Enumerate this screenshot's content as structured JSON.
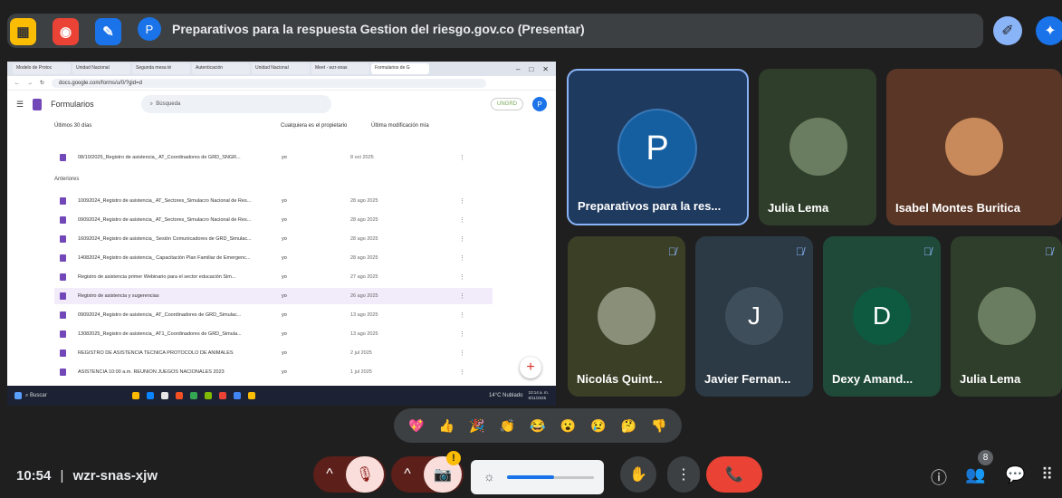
{
  "top_bar": {
    "title": "Preparativos para la respuesta Gestion del riesgo.gov.co (Presentar)",
    "avatar_letter": "P"
  },
  "shared_screen": {
    "tabs": [
      "Modelo de Protoc",
      "Unidad Nacional",
      "Segunda mesa té",
      "Autenticación",
      "Unidad Nacional",
      "Meet - wzr-snas",
      "Formularios de G"
    ],
    "url": "docs.google.com/forms/u/0/?gid=d",
    "forms_label": "Formularios",
    "search_placeholder": "Búsqueda",
    "badge": "UNGRD",
    "filter_range": "Últimos 30 días",
    "filter_owner": "Cualquiera es el propietario",
    "filter_modified": "Última modificación mía",
    "section_older": "Anteriores",
    "rows": [
      {
        "name": "08/10/2025_Registro de asistencia_ AT_Coordinadores de GRD_SNGR...",
        "owner": "yo",
        "date": "8 oct 2025"
      },
      {
        "name": "10092024_Registro de asistencia_ AT_Sectores_Simulacro Nacional de Res...",
        "owner": "yo",
        "date": "28 ago 2025"
      },
      {
        "name": "09092024_Registro de asistencia_ AT_Sectores_Simulacro Nacional de Res...",
        "owner": "yo",
        "date": "28 ago 2025"
      },
      {
        "name": "16092024_Registro de asistencia_ Sesión Comunicadores de GRD_Simulac...",
        "owner": "yo",
        "date": "28 ago 2025"
      },
      {
        "name": "14082024_Registro de asistencia_ Capacitación Plan Familiar de Emergenc...",
        "owner": "yo",
        "date": "28 ago 2025"
      },
      {
        "name": "Registro de asistencia primer Webinario para el sector educación Sim...",
        "owner": "yo",
        "date": "27 ago 2025"
      },
      {
        "name": "Registro de asistencia y sugerencias",
        "owner": "yo",
        "date": "26 ago 2025"
      },
      {
        "name": "09092024_Registro de asistencia_ AT_Coordinadores de GRD_Simulac...",
        "owner": "yo",
        "date": "13 ago 2025"
      },
      {
        "name": "13082025_Registro de asistencia_ AT1_Coordinadores de GRD_Simula...",
        "owner": "yo",
        "date": "13 ago 2025"
      },
      {
        "name": "REGISTRO DE ASISTENCIA TECNICA PROTOCOLO DE ANIMALES",
        "owner": "yo",
        "date": "2 jul 2025"
      },
      {
        "name": "ASISTENCIA 10:00 a.m. REUNIÓN JUEGOS NACIONALES 2023",
        "owner": "yo",
        "date": "1 jul 2025"
      }
    ],
    "taskbar_search": "Buscar",
    "weather": "14°C Nublado",
    "clock_time": "10:14 a. m.",
    "clock_date": "8/11/2025"
  },
  "participants": [
    {
      "name": "Preparativos para la res...",
      "initial": "P"
    },
    {
      "name": "Julia Lema"
    },
    {
      "name": "Isabel Montes Buritica"
    },
    {
      "name": "Nicolás Quint..."
    },
    {
      "name": "Javier Fernan...",
      "initial": "J"
    },
    {
      "name": "Dexy Amand...",
      "initial": "D"
    },
    {
      "name": "Julia Lema"
    }
  ],
  "reactions": [
    "💖",
    "👍",
    "🎉",
    "👏",
    "😂",
    "😮",
    "😢",
    "🤔",
    "👎"
  ],
  "bottom": {
    "time": "10:54",
    "separator": "|",
    "meeting_code": "wzr-snas-xjw",
    "people_count": "8",
    "alert": "!"
  },
  "icons": {
    "chevron": "^",
    "mic_off": "🎙",
    "cam_off": "📷",
    "hand": "✋",
    "more": "⋮",
    "hangup": "📞",
    "info": "ⓘ",
    "people": "👥",
    "chat": "💬",
    "activities": "⠿"
  },
  "colors": {
    "hangup": "#ea4335",
    "mic_bg": "#5c1f1a",
    "active_tile_border": "#8ab4f8"
  }
}
